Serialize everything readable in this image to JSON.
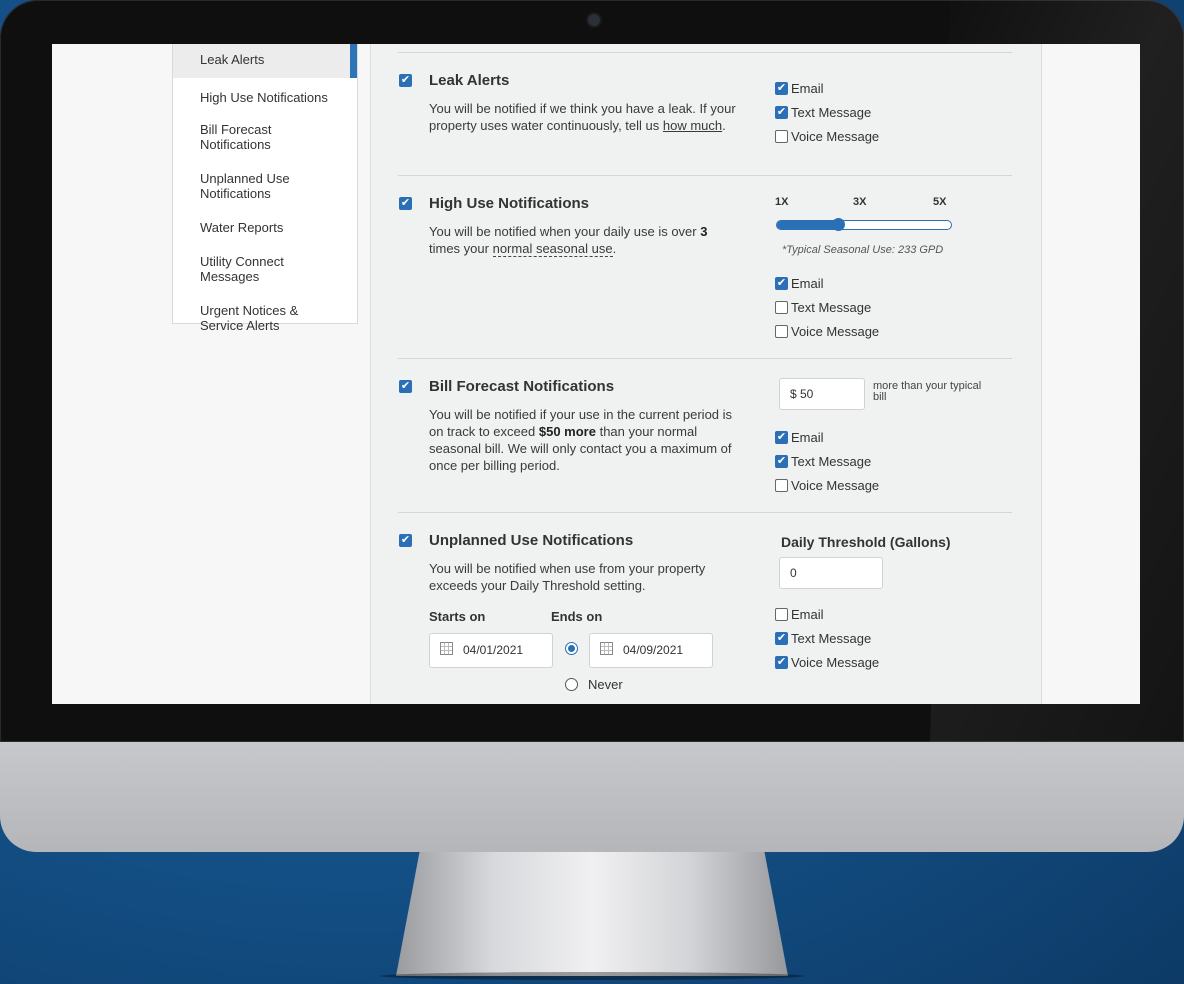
{
  "sidebar": {
    "items": [
      {
        "label": "Leak Alerts"
      },
      {
        "label": "High Use Notifications"
      },
      {
        "label": "Bill Forecast Notifications"
      },
      {
        "label": "Unplanned Use Notifications"
      },
      {
        "label": "Water Reports"
      },
      {
        "label": "Utility Connect Messages"
      },
      {
        "label": "Urgent Notices & Service Alerts"
      }
    ]
  },
  "leak": {
    "title": "Leak Alerts",
    "desc1": "You will be notified if we think you have a leak. If your property uses water continuously, tell us",
    "link": "how much",
    "desc_end": ".",
    "enabled": true,
    "email": "Email",
    "text": "Text Message",
    "voice": "Voice Message"
  },
  "high_use": {
    "title": "High Use Notifications",
    "desc1": "You will be notified when your daily use is over",
    "multiplier": "3",
    "desc2": "times your",
    "link": "normal seasonal use",
    "desc_end": ".",
    "slider_labels": [
      "1X",
      "3X",
      "5X"
    ],
    "slider_value": 3,
    "typical_note": "*Typical Seasonal Use: 233 GPD",
    "email": "Email",
    "text": "Text Message",
    "voice": "Voice Message"
  },
  "bill": {
    "title": "Bill Forecast Notifications",
    "desc1": "You will be notified if your use in the current period is on track to exceed",
    "bold": "$50 more",
    "desc2": "than your normal seasonal bill. We will only contact you a maximum of once per billing period.",
    "amount": "$  50",
    "amount_note": "more than your typical bill",
    "email": "Email",
    "text": "Text Message",
    "voice": "Voice Message"
  },
  "unplanned": {
    "title": "Unplanned Use Notifications",
    "desc": "You will be notified when use from your property exceeds your Daily Threshold setting.",
    "threshold_label": "Daily Threshold (Gallons)",
    "threshold_value": "0",
    "starts_label": "Starts on",
    "ends_label": "Ends on",
    "start_date": "04/01/2021",
    "end_date": "04/09/2021",
    "never_label": "Never",
    "email": "Email",
    "text": "Text Message",
    "voice": "Voice Message"
  },
  "colors": {
    "accent": "#2b6fb6",
    "panel": "#f0f1f1"
  }
}
